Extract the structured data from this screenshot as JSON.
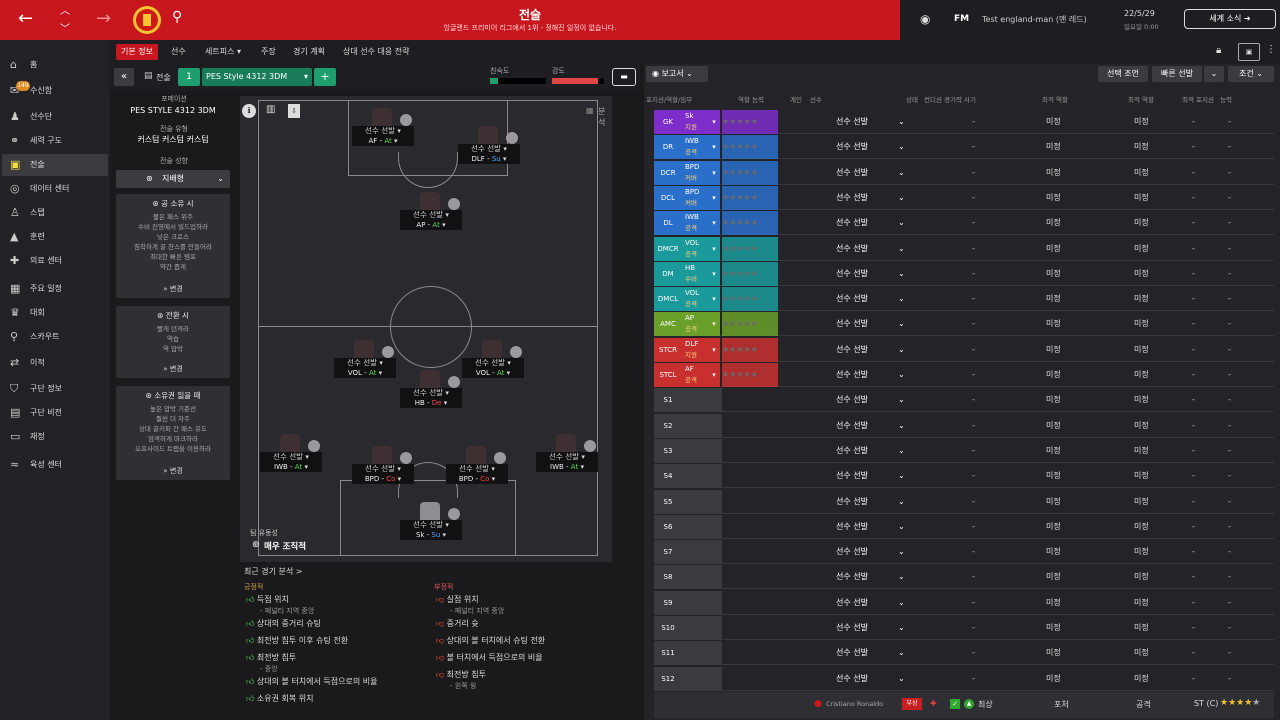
{
  "topbar": {
    "title": "전술",
    "subtitle": "잉글랜드 프리미어 리그에서 1위 - 정해진 일정이 없습니다.",
    "fm_label": "FM",
    "profile": "Test england-man (맨 레드)",
    "date": "22/5/29",
    "time": "일요일 0:00",
    "world_news": "세계 소식"
  },
  "sidebar": {
    "items": [
      {
        "label": "홈",
        "icon": "home-icon"
      },
      {
        "label": "수신함",
        "icon": "inbox-icon",
        "badge": "149"
      },
      {
        "label": "선수단",
        "icon": "squad-icon"
      },
      {
        "label": "세력 구도",
        "icon": "dynamics-icon"
      },
      {
        "label": "전술",
        "icon": "tactics-icon"
      },
      {
        "label": "데이터 센터",
        "icon": "data-icon"
      },
      {
        "label": "스탭",
        "icon": "staff-icon"
      },
      {
        "label": "훈련",
        "icon": "training-icon"
      },
      {
        "label": "의료 센터",
        "icon": "medical-icon"
      },
      {
        "label": "주요 일정",
        "icon": "calendar-icon"
      },
      {
        "label": "대회",
        "icon": "trophy-icon"
      },
      {
        "label": "스카우트",
        "icon": "scout-icon"
      },
      {
        "label": "이적",
        "icon": "transfer-icon"
      },
      {
        "label": "구단 정보",
        "icon": "club-icon"
      },
      {
        "label": "구단 비전",
        "icon": "vision-icon"
      },
      {
        "label": "재정",
        "icon": "finance-icon"
      },
      {
        "label": "육성 센터",
        "icon": "youth-icon"
      }
    ]
  },
  "tabs": [
    "기본 정보",
    "선수",
    "세트피스 ▾",
    "주장",
    "경기 계획",
    "상대 선수 대응 전략"
  ],
  "subbar": {
    "tactic_label": "전술",
    "slot": "1",
    "tactic_name": "PES Style 4312 3DM",
    "fitness_label": "친숙도",
    "intensity_label": "강도"
  },
  "left": {
    "formation_label": "포메이션",
    "formation_value": "PES STYLE 4312 3DM",
    "style_label": "전술 유형",
    "style_value": "커스텀 커스텀 커스텀",
    "mentality_label": "전술 성향",
    "mentality_value": "지배형",
    "in_possession": {
      "title": "공 소유 시",
      "lines": [
        "짧은 패스 위주",
        "수비 진영에서 빌드업하라",
        "낮은 크로스",
        "침착하게 골 찬스를 만들어라",
        "최대한 빠른 템포",
        "약간 좁게"
      ],
      "button": "변경"
    },
    "in_transition": {
      "title": "전환 시",
      "lines": [
        "빨게 던져라",
        "역습",
        "역 압박"
      ],
      "button": "변경"
    },
    "out_possession": {
      "title": "소유권 잃을 때",
      "lines": [
        "높은 압박 기준선",
        "훨씬 더 자주",
        "상대 골키퍼 간 패스 유도",
        "엄격하게 마크하라",
        "오프사이드 트랩을 이용하라"
      ],
      "button": "변경"
    }
  },
  "pitch": {
    "fluidity_label": "팀 유동성",
    "fluidity_value": "매우 조직적",
    "analysis_label": "분석",
    "players": [
      {
        "name": "선수 선발",
        "role": "AF",
        "duty": "At",
        "cls": "duty-at"
      },
      {
        "name": "선수 선발",
        "role": "DLF",
        "duty": "Su",
        "cls": "duty-su"
      },
      {
        "name": "선수 선발",
        "role": "AP",
        "duty": "At",
        "cls": "duty-at"
      },
      {
        "name": "선수 선발",
        "role": "VOL",
        "duty": "At",
        "cls": "duty-at"
      },
      {
        "name": "선수 선발",
        "role": "VOL",
        "duty": "At",
        "cls": "duty-at"
      },
      {
        "name": "선수 선발",
        "role": "HB",
        "duty": "De",
        "cls": "duty-de"
      },
      {
        "name": "선수 선발",
        "role": "IWB",
        "duty": "At",
        "cls": "duty-at"
      },
      {
        "name": "선수 선발",
        "role": "BPD",
        "duty": "Co",
        "cls": "duty-co"
      },
      {
        "name": "선수 선발",
        "role": "BPD",
        "duty": "Co",
        "cls": "duty-co"
      },
      {
        "name": "선수 선발",
        "role": "IWB",
        "duty": "At",
        "cls": "duty-at"
      },
      {
        "name": "선수 선발",
        "role": "Sk",
        "duty": "Su",
        "cls": "duty-su"
      }
    ]
  },
  "analysis": {
    "title": "최근 경기 분석 >",
    "positive_label": "긍정적",
    "negative_label": "부정적",
    "positive": [
      {
        "text": "득점 위치",
        "sub": "- 페널티 지역 중앙"
      },
      {
        "text": "상대의 중거리 슈팅",
        "sub": ""
      },
      {
        "text": "최전방 침투 이후 슈팅 전환",
        "sub": ""
      },
      {
        "text": "최전방 침투",
        "sub": "- 중앙"
      },
      {
        "text": "상대의 볼 터치에서 득점으로의 비율",
        "sub": ""
      },
      {
        "text": "소유권 회복 위치",
        "sub": ""
      }
    ],
    "negative": [
      {
        "text": "실점 위치",
        "sub": "- 페널티 지역 중앙"
      },
      {
        "text": "중거리 슛",
        "sub": ""
      },
      {
        "text": "상대의 볼 터치에서 슈팅 전환",
        "sub": ""
      },
      {
        "text": "볼 터치에서 득점으로의 비율",
        "sub": ""
      },
      {
        "text": "최전방 침투",
        "sub": "- 왼쪽 윙"
      }
    ]
  },
  "right": {
    "report_label": "보고서",
    "selection_btn": "선택 조언",
    "quick_btn": "빠른 선발",
    "conditions_btn": "조건",
    "headers": [
      "포지션/역할/임무",
      "역할 능력",
      "계인",
      "선수",
      "상태",
      "컨디션 경기력 사기",
      "최적 역할",
      "최적 역할",
      "최적 포지션",
      "능력"
    ],
    "rows": [
      {
        "pos": "GK",
        "role": "Sk",
        "duty": "지원",
        "color": "#7d2dc9",
        "sel": "선수 선발",
        "d1": "-",
        "v1": "미정",
        "v2": "미정",
        "d2": "-",
        "d3": "-"
      },
      {
        "pos": "DR",
        "role": "IWB",
        "duty": "공격",
        "color": "#2a6fc9",
        "sel": "선수 선발",
        "d1": "-",
        "v1": "미정",
        "v2": "미정",
        "d2": "-",
        "d3": "-"
      },
      {
        "pos": "DCR",
        "role": "BPD",
        "duty": "커버",
        "color": "#2a6fc9",
        "sel": "선수 선발",
        "d1": "-",
        "v1": "미정",
        "v2": "미정",
        "d2": "-",
        "d3": "-"
      },
      {
        "pos": "DCL",
        "role": "BPD",
        "duty": "커버",
        "color": "#2a6fc9",
        "sel": "선수 선발",
        "d1": "-",
        "v1": "미정",
        "v2": "미정",
        "d2": "-",
        "d3": "-"
      },
      {
        "pos": "DL",
        "role": "IWB",
        "duty": "공격",
        "color": "#2a6fc9",
        "sel": "선수 선발",
        "d1": "-",
        "v1": "미정",
        "v2": "미정",
        "d2": "-",
        "d3": "-"
      },
      {
        "pos": "DMCR",
        "role": "VOL",
        "duty": "공격",
        "color": "#1a9a9a",
        "sel": "선수 선발",
        "d1": "-",
        "v1": "미정",
        "v2": "미정",
        "d2": "-",
        "d3": "-"
      },
      {
        "pos": "DM",
        "role": "HB",
        "duty": "수비",
        "color": "#1a9a9a",
        "sel": "선수 선발",
        "d1": "-",
        "v1": "미정",
        "v2": "미정",
        "d2": "-",
        "d3": "-"
      },
      {
        "pos": "DMCL",
        "role": "VOL",
        "duty": "공격",
        "color": "#1a9a9a",
        "sel": "선수 선발",
        "d1": "-",
        "v1": "미정",
        "v2": "미정",
        "d2": "-",
        "d3": "-"
      },
      {
        "pos": "AMC",
        "role": "AP",
        "duty": "공격",
        "color": "#6aa02a",
        "sel": "선수 선발",
        "d1": "-",
        "v1": "미정",
        "v2": "미정",
        "d2": "-",
        "d3": "-"
      },
      {
        "pos": "STCR",
        "role": "DLF",
        "duty": "지원",
        "color": "#c83030",
        "sel": "선수 선발",
        "d1": "-",
        "v1": "미정",
        "v2": "미정",
        "d2": "-",
        "d3": "-"
      },
      {
        "pos": "STCL",
        "role": "AF",
        "duty": "공격",
        "color": "#c83030",
        "sel": "선수 선발",
        "d1": "-",
        "v1": "미정",
        "v2": "미정",
        "d2": "-",
        "d3": "-"
      },
      {
        "pos": "S1",
        "role": "",
        "duty": "",
        "color": "",
        "sel": "선수 선발",
        "d1": "-",
        "v1": "미정",
        "v2": "미정",
        "d2": "-",
        "d3": "-"
      },
      {
        "pos": "S2",
        "role": "",
        "duty": "",
        "color": "",
        "sel": "선수 선발",
        "d1": "-",
        "v1": "미정",
        "v2": "미정",
        "d2": "-",
        "d3": "-"
      },
      {
        "pos": "S3",
        "role": "",
        "duty": "",
        "color": "",
        "sel": "선수 선발",
        "d1": "-",
        "v1": "미정",
        "v2": "미정",
        "d2": "-",
        "d3": "-"
      },
      {
        "pos": "S4",
        "role": "",
        "duty": "",
        "color": "",
        "sel": "선수 선발",
        "d1": "-",
        "v1": "미정",
        "v2": "미정",
        "d2": "-",
        "d3": "-"
      },
      {
        "pos": "S5",
        "role": "",
        "duty": "",
        "color": "",
        "sel": "선수 선발",
        "d1": "-",
        "v1": "미정",
        "v2": "미정",
        "d2": "-",
        "d3": "-"
      },
      {
        "pos": "S6",
        "role": "",
        "duty": "",
        "color": "",
        "sel": "선수 선발",
        "d1": "-",
        "v1": "미정",
        "v2": "미정",
        "d2": "-",
        "d3": "-"
      },
      {
        "pos": "S7",
        "role": "",
        "duty": "",
        "color": "",
        "sel": "선수 선발",
        "d1": "-",
        "v1": "미정",
        "v2": "미정",
        "d2": "-",
        "d3": "-"
      },
      {
        "pos": "S8",
        "role": "",
        "duty": "",
        "color": "",
        "sel": "선수 선발",
        "d1": "-",
        "v1": "미정",
        "v2": "미정",
        "d2": "-",
        "d3": "-"
      },
      {
        "pos": "S9",
        "role": "",
        "duty": "",
        "color": "",
        "sel": "선수 선발",
        "d1": "-",
        "v1": "미정",
        "v2": "미정",
        "d2": "-",
        "d3": "-"
      },
      {
        "pos": "S10",
        "role": "",
        "duty": "",
        "color": "",
        "sel": "선수 선발",
        "d1": "-",
        "v1": "미정",
        "v2": "미정",
        "d2": "-",
        "d3": "-"
      },
      {
        "pos": "S11",
        "role": "",
        "duty": "",
        "color": "",
        "sel": "선수 선발",
        "d1": "-",
        "v1": "미정",
        "v2": "미정",
        "d2": "-",
        "d3": "-"
      },
      {
        "pos": "S12",
        "role": "",
        "duty": "",
        "color": "",
        "sel": "선수 선발",
        "d1": "-",
        "v1": "미정",
        "v2": "미정",
        "d2": "-",
        "d3": "-"
      }
    ],
    "bottom_row": {
      "player": "Cristiano Ronaldo",
      "status": "부상",
      "condition": "최상",
      "role1": "포처",
      "role2": "공격",
      "pos": "ST (C)"
    }
  },
  "colors": {
    "accent": "#c8161e",
    "panel": "#242428"
  }
}
